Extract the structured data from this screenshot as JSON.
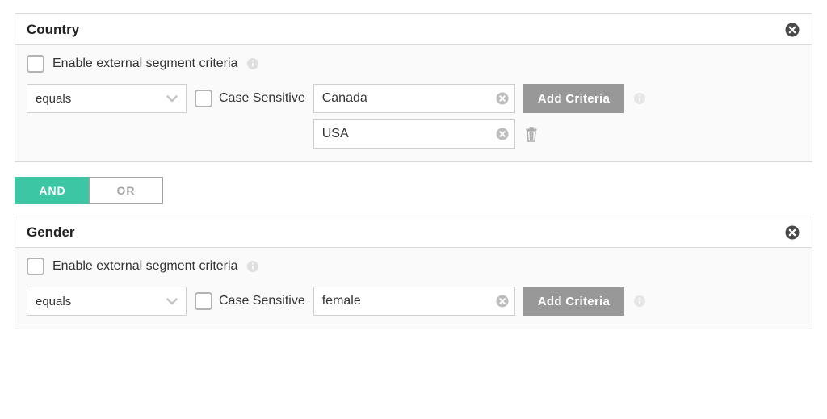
{
  "filters": [
    {
      "title": "Country",
      "enable_label": "Enable external segment criteria",
      "enable_checked": false,
      "operator": "equals",
      "case_sensitive_label": "Case Sensitive",
      "case_sensitive_checked": false,
      "values": [
        "Canada",
        "USA"
      ],
      "add_label": "Add Criteria"
    },
    {
      "title": "Gender",
      "enable_label": "Enable external segment criteria",
      "enable_checked": false,
      "operator": "equals",
      "case_sensitive_label": "Case Sensitive",
      "case_sensitive_checked": false,
      "values": [
        "female"
      ],
      "add_label": "Add Criteria"
    }
  ],
  "connector": {
    "and_label": "AND",
    "or_label": "OR",
    "active": "and"
  }
}
